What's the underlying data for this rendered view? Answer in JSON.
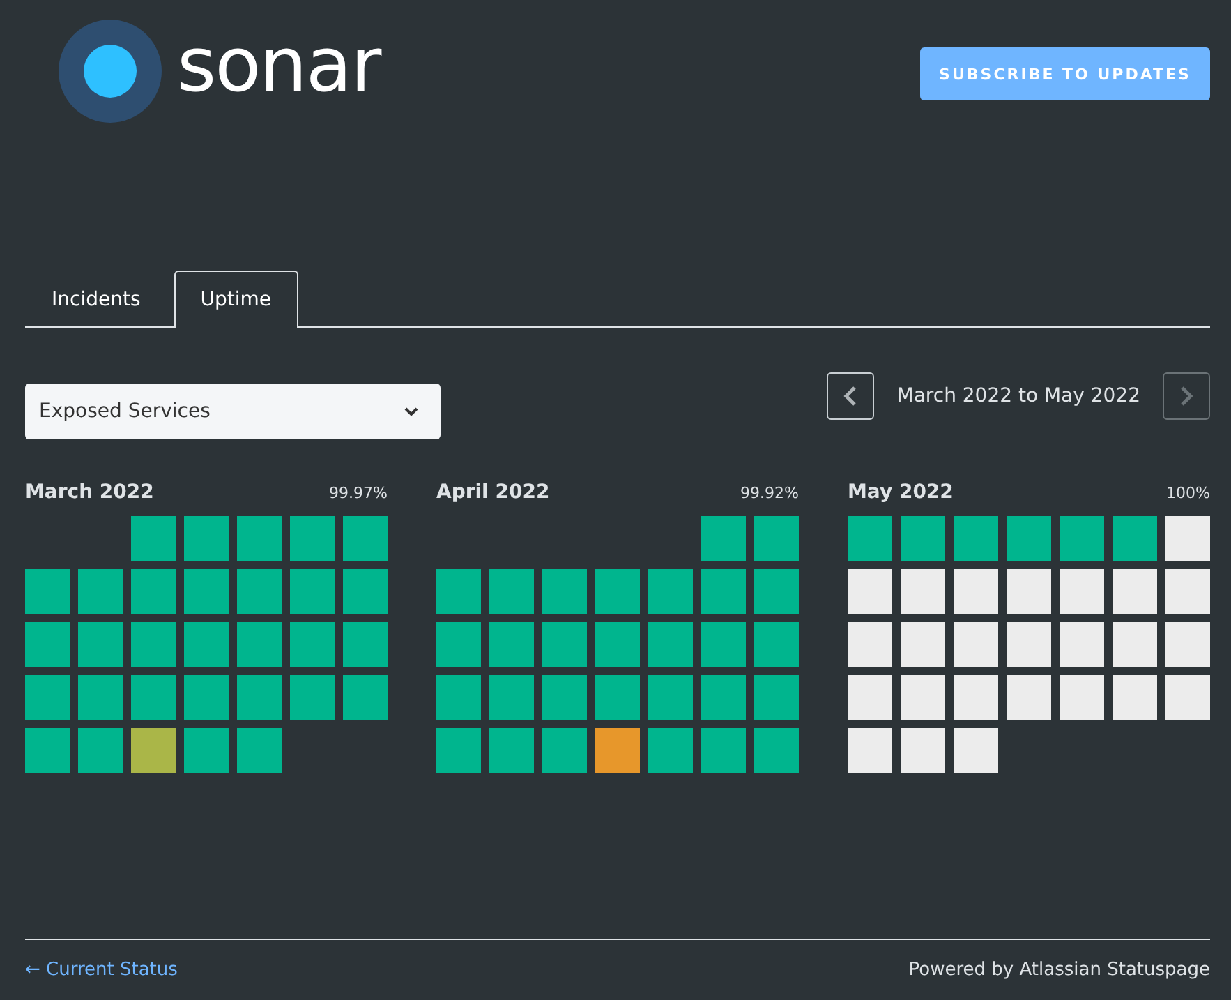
{
  "header": {
    "logo_text": "sonar",
    "subscribe_button": "SUBSCRIBE TO UPDATES"
  },
  "tabs": [
    {
      "label": "Incidents",
      "selected": false
    },
    {
      "label": "Uptime",
      "selected": true
    }
  ],
  "component_select": {
    "value": "Exposed Services"
  },
  "range": {
    "label": "March 2022 to May 2022",
    "prev_disabled": false,
    "next_disabled": true
  },
  "months": [
    {
      "name": "March 2022",
      "uptime": "99.97%",
      "days": [
        {
          "kind": "blank"
        },
        {
          "kind": "blank"
        },
        {
          "kind": "up"
        },
        {
          "kind": "up"
        },
        {
          "kind": "up"
        },
        {
          "kind": "up"
        },
        {
          "kind": "up"
        },
        {
          "kind": "up"
        },
        {
          "kind": "up"
        },
        {
          "kind": "up"
        },
        {
          "kind": "up"
        },
        {
          "kind": "up"
        },
        {
          "kind": "up"
        },
        {
          "kind": "up"
        },
        {
          "kind": "up"
        },
        {
          "kind": "up"
        },
        {
          "kind": "up"
        },
        {
          "kind": "up"
        },
        {
          "kind": "up"
        },
        {
          "kind": "up"
        },
        {
          "kind": "up"
        },
        {
          "kind": "up"
        },
        {
          "kind": "up"
        },
        {
          "kind": "up"
        },
        {
          "kind": "up"
        },
        {
          "kind": "up"
        },
        {
          "kind": "up"
        },
        {
          "kind": "up"
        },
        {
          "kind": "up"
        },
        {
          "kind": "up"
        },
        {
          "kind": "minor"
        },
        {
          "kind": "up"
        },
        {
          "kind": "up"
        }
      ]
    },
    {
      "name": "April 2022",
      "uptime": "99.92%",
      "days": [
        {
          "kind": "blank"
        },
        {
          "kind": "blank"
        },
        {
          "kind": "blank"
        },
        {
          "kind": "blank"
        },
        {
          "kind": "blank"
        },
        {
          "kind": "up"
        },
        {
          "kind": "up"
        },
        {
          "kind": "up"
        },
        {
          "kind": "up"
        },
        {
          "kind": "up"
        },
        {
          "kind": "up"
        },
        {
          "kind": "up"
        },
        {
          "kind": "up"
        },
        {
          "kind": "up"
        },
        {
          "kind": "up"
        },
        {
          "kind": "up"
        },
        {
          "kind": "up"
        },
        {
          "kind": "up"
        },
        {
          "kind": "up"
        },
        {
          "kind": "up"
        },
        {
          "kind": "up"
        },
        {
          "kind": "up"
        },
        {
          "kind": "up"
        },
        {
          "kind": "up"
        },
        {
          "kind": "up"
        },
        {
          "kind": "up"
        },
        {
          "kind": "up"
        },
        {
          "kind": "up"
        },
        {
          "kind": "up"
        },
        {
          "kind": "up"
        },
        {
          "kind": "up"
        },
        {
          "kind": "partial"
        },
        {
          "kind": "up"
        },
        {
          "kind": "up"
        },
        {
          "kind": "up"
        }
      ]
    },
    {
      "name": "May 2022",
      "uptime": "100%",
      "days": [
        {
          "kind": "up"
        },
        {
          "kind": "up"
        },
        {
          "kind": "up"
        },
        {
          "kind": "up"
        },
        {
          "kind": "up"
        },
        {
          "kind": "up"
        },
        {
          "kind": "future"
        },
        {
          "kind": "future"
        },
        {
          "kind": "future"
        },
        {
          "kind": "future"
        },
        {
          "kind": "future"
        },
        {
          "kind": "future"
        },
        {
          "kind": "future"
        },
        {
          "kind": "future"
        },
        {
          "kind": "future"
        },
        {
          "kind": "future"
        },
        {
          "kind": "future"
        },
        {
          "kind": "future"
        },
        {
          "kind": "future"
        },
        {
          "kind": "future"
        },
        {
          "kind": "future"
        },
        {
          "kind": "future"
        },
        {
          "kind": "future"
        },
        {
          "kind": "future"
        },
        {
          "kind": "future"
        },
        {
          "kind": "future"
        },
        {
          "kind": "future"
        },
        {
          "kind": "future"
        },
        {
          "kind": "future"
        },
        {
          "kind": "future"
        },
        {
          "kind": "future"
        }
      ]
    }
  ],
  "footer": {
    "back_link": "← Current Status",
    "powered_by": "Powered by Atlassian Statuspage"
  }
}
